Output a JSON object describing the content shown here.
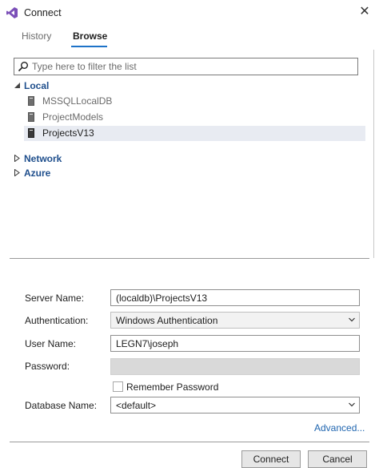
{
  "window": {
    "title": "Connect",
    "close_glyph": "✕"
  },
  "tabs": [
    {
      "label": "History",
      "active": false
    },
    {
      "label": "Browse",
      "active": true
    }
  ],
  "filter": {
    "placeholder": "Type here to filter the list",
    "value": ""
  },
  "tree": {
    "local": {
      "label": "Local",
      "expanded": true,
      "servers": [
        {
          "label": "MSSQLLocalDB",
          "selected": false
        },
        {
          "label": "ProjectModels",
          "selected": false
        },
        {
          "label": "ProjectsV13",
          "selected": true
        }
      ]
    },
    "network": {
      "label": "Network",
      "expanded": false
    },
    "azure": {
      "label": "Azure",
      "expanded": false
    }
  },
  "form": {
    "server_name_label": "Server Name:",
    "server_name_value": "(localdb)\\ProjectsV13",
    "authentication_label": "Authentication:",
    "authentication_value": "Windows Authentication",
    "user_name_label": "User Name:",
    "user_name_value": "LEGN7\\joseph",
    "password_label": "Password:",
    "password_value": "",
    "remember_password_label": "Remember Password",
    "remember_password_checked": false,
    "database_name_label": "Database Name:",
    "database_name_value": "<default>",
    "advanced_link": "Advanced..."
  },
  "buttons": {
    "connect": "Connect",
    "cancel": "Cancel"
  },
  "colors": {
    "accent": "#1e73c8",
    "tree_group": "#1e4e8c",
    "link": "#2066b0",
    "selection": "#e8ebf2"
  },
  "icons": {
    "app": "visual-studio-icon",
    "filter": "search-icon",
    "server": "database-server-icon",
    "dropdown": "chevron-down-icon"
  }
}
